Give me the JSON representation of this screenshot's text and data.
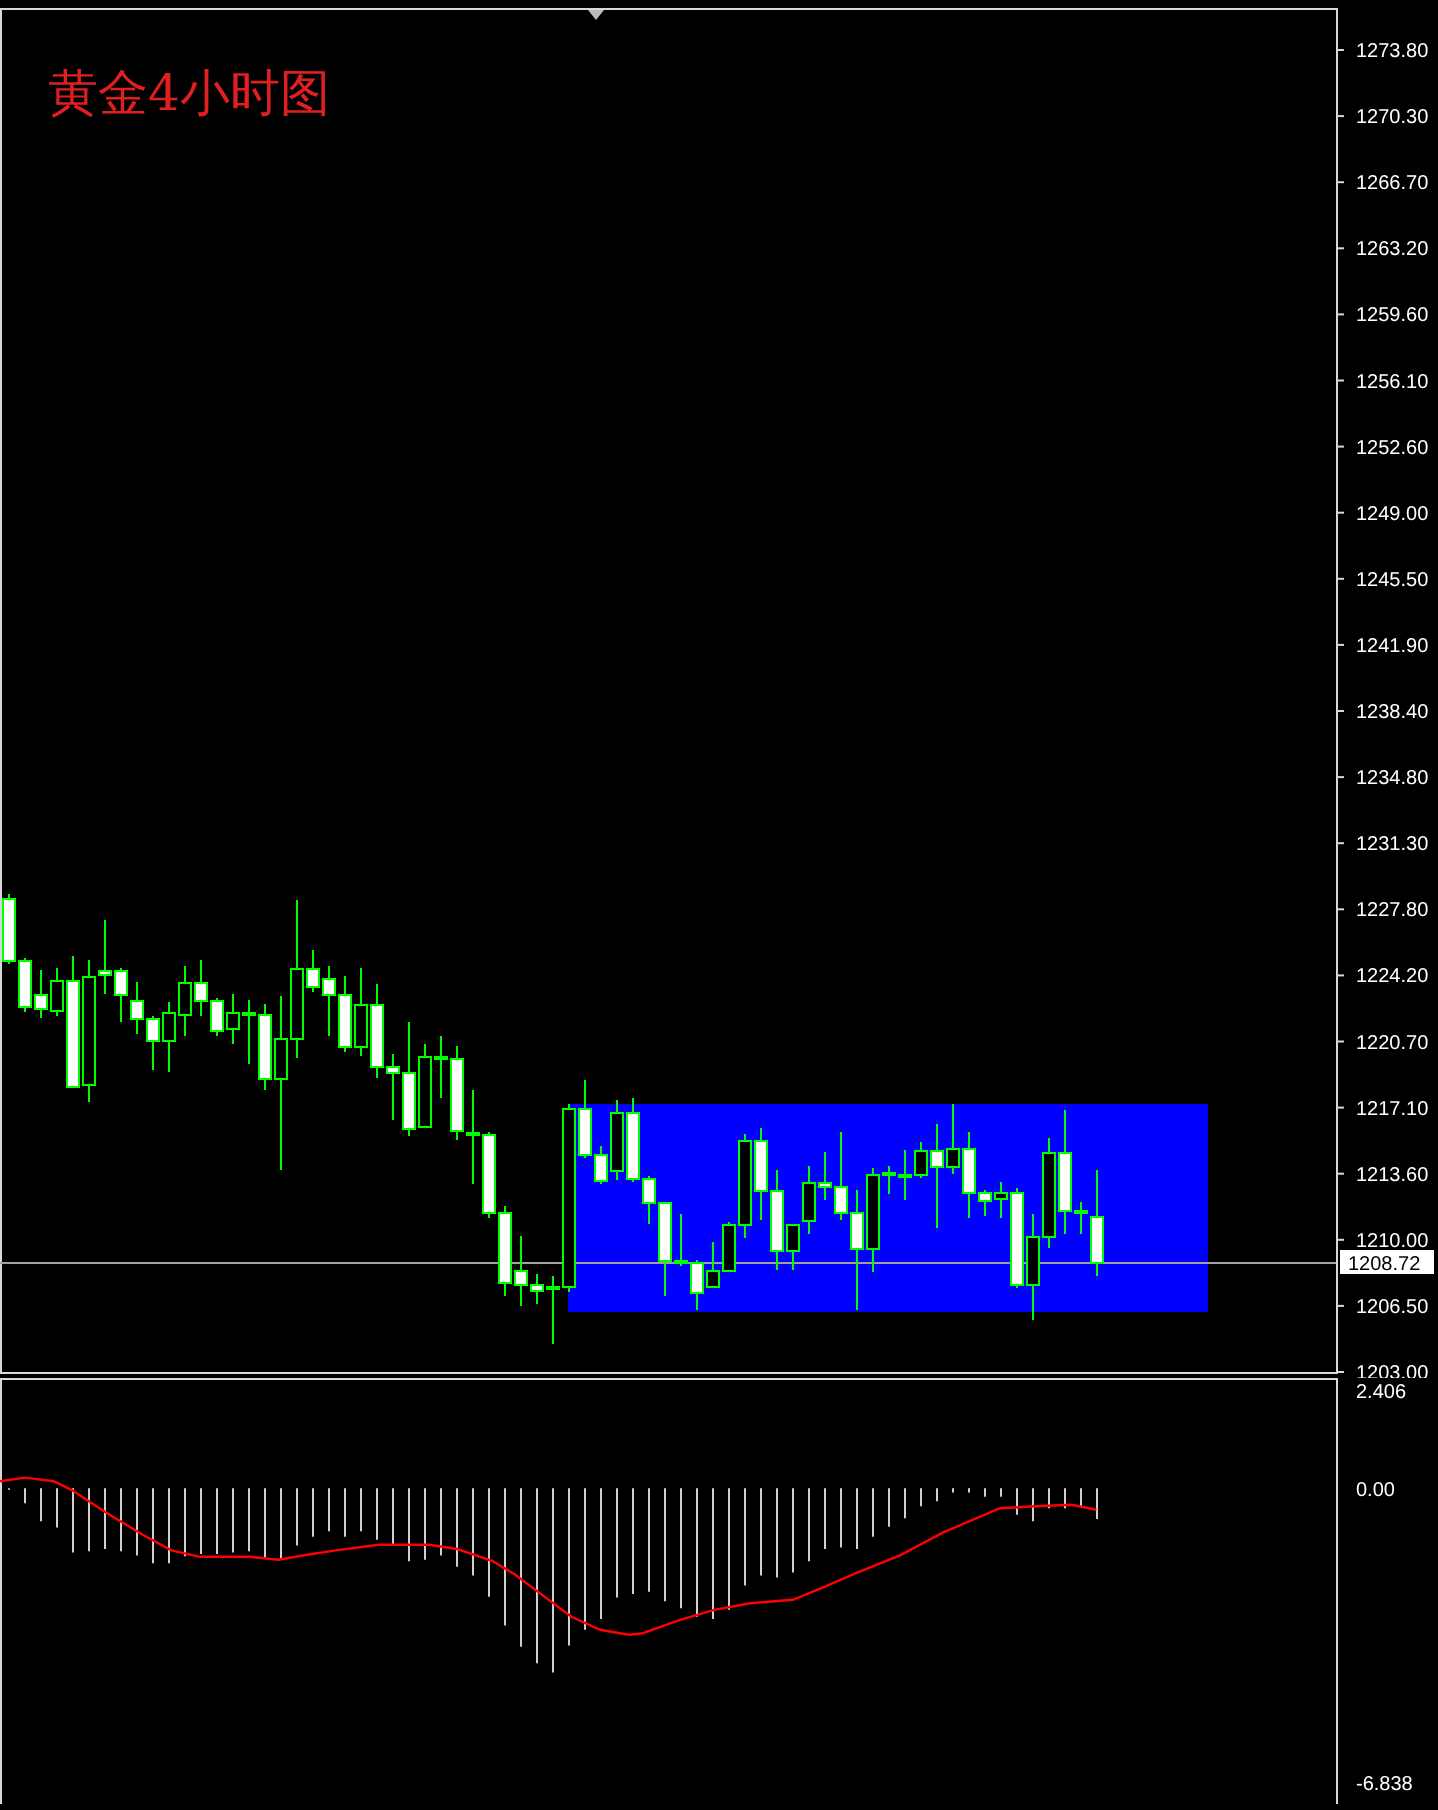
{
  "title": "黄金4小时图",
  "price_axis": {
    "labels": [
      "1273.80",
      "1270.30",
      "1266.70",
      "1263.20",
      "1259.60",
      "1256.10",
      "1252.60",
      "1249.00",
      "1245.50",
      "1241.90",
      "1238.40",
      "1234.80",
      "1231.30",
      "1227.80",
      "1224.20",
      "1220.70",
      "1217.10",
      "1213.60",
      "1210.00",
      "1206.50",
      "1203.00"
    ],
    "current_price": "1208.72"
  },
  "macd_axis": {
    "labels": [
      "2.406",
      "0.00",
      "-6.838"
    ]
  }
}
